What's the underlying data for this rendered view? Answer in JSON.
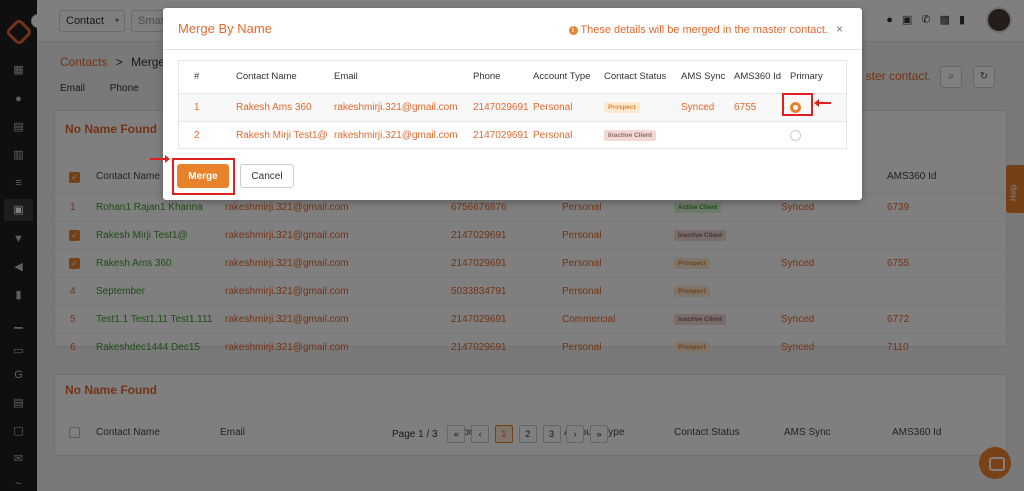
{
  "topbar": {
    "filter_select": "Contact",
    "search_placeholder": "Smar"
  },
  "breadcrumb": {
    "root": "Contacts",
    "sep": ">",
    "current": "Merge C"
  },
  "subtabs": [
    "Email",
    "Phone",
    "N"
  ],
  "right_note": "ster contact.",
  "background": {
    "card1": {
      "title": "No Name Found",
      "headers": {
        "contact_name": "Contact Name",
        "ams360_id": "AMS360 Id"
      },
      "rows": [
        {
          "num": "1",
          "checked": false,
          "name": "Rohan1 Rajan1 Khanna",
          "email": "rakeshmirji.321@gmail.com",
          "phone": "6756676876",
          "type": "Personal",
          "status": "Active Client",
          "status_color": "green",
          "sync": "Synced",
          "ams": "6739"
        },
        {
          "num": "",
          "checked": true,
          "name": "Rakesh Mirji Test1@",
          "email": "rakeshmirji.321@gmail.com",
          "phone": "2147029691",
          "type": "Personal",
          "status": "Inactive Client",
          "status_color": "grey",
          "sync": "",
          "ams": ""
        },
        {
          "num": "",
          "checked": true,
          "name": "Rakesh Ams 360",
          "email": "rakeshmirji.321@gmail.com",
          "phone": "2147029691",
          "type": "Personal",
          "status": "Prospect",
          "status_color": "orange",
          "sync": "Synced",
          "ams": "6755"
        },
        {
          "num": "4",
          "checked": false,
          "name": "September",
          "email": "rakeshmirji.321@gmail.com",
          "phone": "5033834791",
          "type": "Personal",
          "status": "Prospect",
          "status_color": "orange",
          "sync": "",
          "ams": ""
        },
        {
          "num": "5",
          "checked": false,
          "name": "Test1.1 Test1,11 Test1.111",
          "email": "rakeshmirji.321@gmail.com",
          "phone": "2147029691",
          "type": "Commercial",
          "status": "Inactive Client",
          "status_color": "grey",
          "sync": "Synced",
          "ams": "6772"
        },
        {
          "num": "6",
          "checked": false,
          "name": "Rakeshdec1444 Dec15",
          "email": "rakeshmirji.321@gmail.com",
          "phone": "2147029691",
          "type": "Personal",
          "status": "Prospect",
          "status_color": "orange",
          "sync": "Synced",
          "ams": "7110"
        }
      ]
    },
    "card2": {
      "title": "No Name Found",
      "headers": {
        "contact_name": "Contact Name",
        "email": "Email",
        "phone": "Phone",
        "account_type": "Account Type",
        "contact_status": "Contact Status",
        "ams_sync": "AMS Sync",
        "ams360_id": "AMS360 Id"
      }
    }
  },
  "pagination": {
    "label": "Page 1 / 3",
    "first": "«",
    "prev": "‹",
    "pages": [
      "1",
      "2",
      "3"
    ],
    "next": "›",
    "last": "»",
    "current": "1"
  },
  "help_label": "Help",
  "modal": {
    "title": "Merge By Name",
    "note": "These details will be merged in the master contact.",
    "close": "×",
    "headers": {
      "num": "#",
      "contact_name": "Contact Name",
      "email": "Email",
      "phone": "Phone",
      "account_type": "Account Type",
      "contact_status": "Contact Status",
      "ams_sync": "AMS Sync",
      "ams360_id": "AMS360 Id",
      "primary": "Primary"
    },
    "rows": [
      {
        "num": "1",
        "name": "Rakesh Ams 360",
        "email": "rakeshmirji.321@gmail.com",
        "phone": "2147029691",
        "type": "Personal",
        "status": "Prospect",
        "status_color": "orange",
        "sync": "Synced",
        "ams": "6755",
        "primary": true
      },
      {
        "num": "2",
        "name": "Rakesh Mirji Test1@",
        "email": "rakeshmirji.321@gmail.com",
        "phone": "2147029691",
        "type": "Personal",
        "status": "Inactive Client",
        "status_color": "grey",
        "sync": "",
        "ams": "",
        "primary": false
      }
    ],
    "merge_label": "Merge",
    "cancel_label": "Cancel"
  },
  "colors": {
    "accent": "#e8672c",
    "button": "#e8832c",
    "highlight_box": "#e02020",
    "sidebar": "#1f1f23"
  }
}
